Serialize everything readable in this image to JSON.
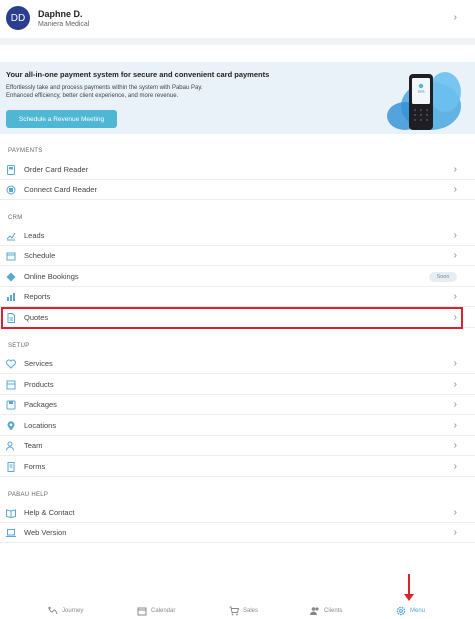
{
  "profile": {
    "initials": "DD",
    "name": "Daphne  D.",
    "company": "Maniera Medical"
  },
  "banner": {
    "title": "Your all-in-one payment system for secure and convenient card payments",
    "desc_line1": "Effortlessly take and process payments within the system with Pabau Pay.",
    "desc_line2": "Enhanced efficiency, better client experience, and more revenue.",
    "button": "Schedule a Revenue Meeting",
    "device_brand": "TIPS"
  },
  "sections": {
    "payments": {
      "label": "PAYMENTS",
      "items": [
        {
          "label": "Order Card Reader",
          "icon": "card-reader-icon"
        },
        {
          "label": "Connect Card Reader",
          "icon": "connect-icon"
        }
      ]
    },
    "crm": {
      "label": "CRM",
      "items": [
        {
          "label": "Leads",
          "icon": "chart-line-icon"
        },
        {
          "label": "Schedule",
          "icon": "calendar-icon"
        },
        {
          "label": "Online Bookings",
          "icon": "diamond-icon",
          "badge": "Soon"
        },
        {
          "label": "Reports",
          "icon": "bar-chart-icon"
        },
        {
          "label": "Quotes",
          "icon": "document-icon"
        }
      ]
    },
    "setup": {
      "label": "SETUP",
      "items": [
        {
          "label": "Services",
          "icon": "heart-icon"
        },
        {
          "label": "Products",
          "icon": "box-icon"
        },
        {
          "label": "Packages",
          "icon": "package-icon"
        },
        {
          "label": "Locations",
          "icon": "location-pin-icon"
        },
        {
          "label": "Team",
          "icon": "users-icon"
        },
        {
          "label": "Forms",
          "icon": "form-icon"
        }
      ]
    },
    "help": {
      "label": "PABAU HELP",
      "items": [
        {
          "label": "Help & Contact",
          "icon": "book-icon"
        },
        {
          "label": "Web Version",
          "icon": "laptop-icon"
        }
      ]
    }
  },
  "tabs": [
    {
      "label": "Journey",
      "icon": "journey-icon"
    },
    {
      "label": "Calendar",
      "icon": "calendar-icon"
    },
    {
      "label": "Sales",
      "icon": "cart-icon"
    },
    {
      "label": "Clients",
      "icon": "clients-icon"
    },
    {
      "label": "Menu",
      "icon": "gear-icon",
      "active": true
    }
  ],
  "colors": {
    "accent": "#4fb6d4",
    "avatar": "#2b3d8f",
    "highlight": "#d9232e",
    "active_tab": "#4fa8d8"
  }
}
